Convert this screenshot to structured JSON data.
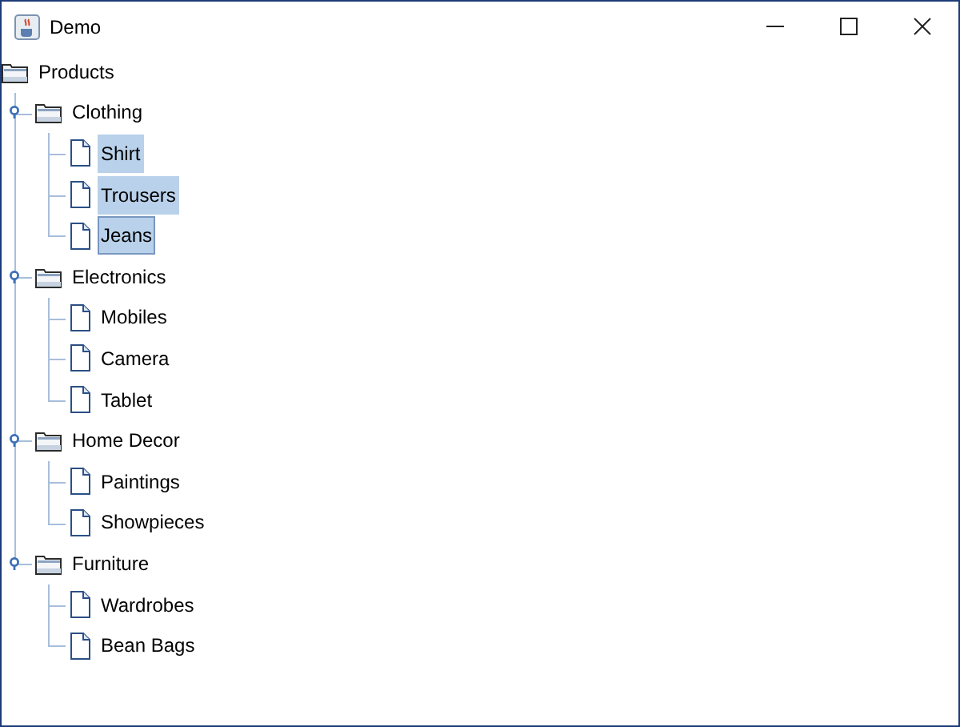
{
  "window": {
    "title": "Demo"
  },
  "tree": {
    "label": "Products",
    "expanded": true,
    "selected": false,
    "focused": false,
    "children": [
      {
        "label": "Clothing",
        "expanded": true,
        "selected": false,
        "focused": false,
        "children": [
          {
            "label": "Shirt",
            "selected": true,
            "focused": false
          },
          {
            "label": "Trousers",
            "selected": true,
            "focused": false
          },
          {
            "label": "Jeans",
            "selected": true,
            "focused": true
          }
        ]
      },
      {
        "label": "Electronics",
        "expanded": true,
        "selected": false,
        "focused": false,
        "children": [
          {
            "label": "Mobiles",
            "selected": false,
            "focused": false
          },
          {
            "label": "Camera",
            "selected": false,
            "focused": false
          },
          {
            "label": "Tablet",
            "selected": false,
            "focused": false
          }
        ]
      },
      {
        "label": "Home Decor",
        "expanded": true,
        "selected": false,
        "focused": false,
        "children": [
          {
            "label": "Paintings",
            "selected": false,
            "focused": false
          },
          {
            "label": "Showpieces",
            "selected": false,
            "focused": false
          }
        ]
      },
      {
        "label": "Furniture",
        "expanded": true,
        "selected": false,
        "focused": false,
        "children": [
          {
            "label": "Wardrobes",
            "selected": false,
            "focused": false
          },
          {
            "label": "Bean Bags",
            "selected": false,
            "focused": false
          }
        ]
      }
    ]
  }
}
